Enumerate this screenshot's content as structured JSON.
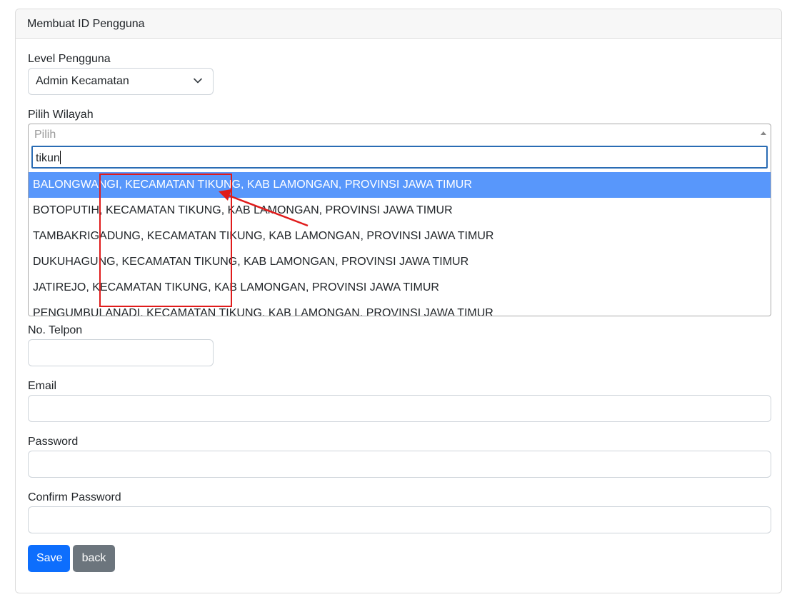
{
  "card": {
    "title": "Membuat ID Pengguna"
  },
  "level": {
    "label": "Level Pengguna",
    "value": "Admin Kecamatan"
  },
  "wilayah": {
    "label": "Pilih Wilayah",
    "placeholder": "Pilih",
    "search_value": "tikun",
    "options": [
      "BALONGWANGI, KECAMATAN TIKUNG, KAB LAMONGAN, PROVINSI JAWA TIMUR",
      "BOTOPUTIH, KECAMATAN TIKUNG, KAB LAMONGAN, PROVINSI JAWA TIMUR",
      "TAMBAKRIGADUNG, KECAMATAN TIKUNG, KAB LAMONGAN, PROVINSI JAWA TIMUR",
      "DUKUHAGUNG, KECAMATAN TIKUNG, KAB LAMONGAN, PROVINSI JAWA TIMUR",
      "JATIREJO, KECAMATAN TIKUNG, KAB LAMONGAN, PROVINSI JAWA TIMUR",
      "PENGUMBULANADI, KECAMATAN TIKUNG, KAB LAMONGAN, PROVINSI JAWA TIMUR"
    ]
  },
  "telpon": {
    "label": "No. Telpon",
    "value": ""
  },
  "email": {
    "label": "Email",
    "value": ""
  },
  "password": {
    "label": "Password",
    "value": ""
  },
  "confirm": {
    "label": "Confirm Password",
    "value": ""
  },
  "buttons": {
    "save": "Save",
    "back": "back"
  },
  "colors": {
    "primary": "#0d6efd",
    "secondary": "#6c757d",
    "highlight": "#5897fb",
    "annotation": "#e01b1b"
  }
}
